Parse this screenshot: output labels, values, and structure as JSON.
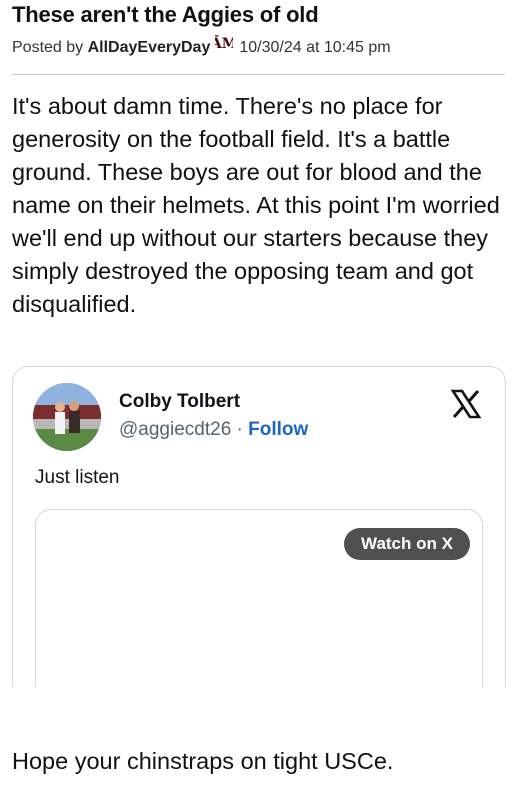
{
  "post": {
    "title": "These aren't the Aggies of old",
    "posted_by_prefix": "Posted by",
    "author": "AllDayEveryDay",
    "author_badge": "ATM",
    "timestamp": "10/30/24 at 10:45 pm",
    "body": "It's about damn time. There's no place for generosity on the football field. It's a battle ground. These boys are out for blood and the name on their helmets. At this point I'm worried we'll end up without our starters because they simply destroyed the opposing team and got disqualified.",
    "footer_text": "Hope your chinstraps on tight USCe."
  },
  "embed": {
    "author_name": "Colby Tolbert",
    "handle": "@aggiecdt26",
    "separator": "·",
    "follow_label": "Follow",
    "text": "Just listen",
    "watch_label": "Watch on X",
    "platform_icon": "x-logo-icon"
  },
  "colors": {
    "follow": "#1d66c4",
    "watch_button": "#505050",
    "aggie_maroon": "#500000"
  }
}
